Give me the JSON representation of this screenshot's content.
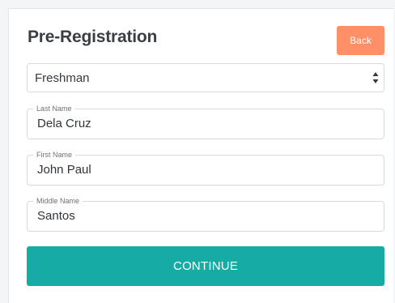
{
  "form": {
    "title": "Pre-Registration",
    "back_label": "Back",
    "level_select": {
      "selected": "Freshman"
    },
    "fields": [
      {
        "label": "Last Name",
        "value": "Dela Cruz"
      },
      {
        "label": "First Name",
        "value": "John Paul"
      },
      {
        "label": "Middle Name",
        "value": "Santos"
      }
    ],
    "continue_label": "CONTINUE"
  },
  "colors": {
    "back_button": "#ff8f66",
    "continue_button": "#16aca5",
    "border": "#d7d9dc"
  },
  "icons": {
    "select_arrows": "up-down-arrows-icon"
  }
}
